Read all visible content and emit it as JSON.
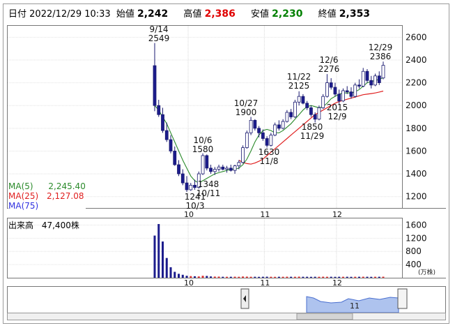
{
  "header": {
    "date_label": "日付",
    "datetime": "2022/12/29 10:33",
    "open_label": "始値",
    "open_value": "2,242",
    "high_label": "高値",
    "high_value": "2,386",
    "low_label": "安値",
    "low_value": "2,230",
    "close_label": "終値",
    "close_value": "2,353",
    "colors": {
      "high": "#e00000",
      "low": "#008000",
      "text": "#000000"
    }
  },
  "legend": {
    "ma5_label": "MA(5)",
    "ma5_value": "2,245.40",
    "ma5_color": "#2a8a2a",
    "ma25_label": "MA(25)",
    "ma25_value": "2,127.08",
    "ma25_color": "#e02020",
    "ma75_label": "MA(75)",
    "ma75_color": "#3030e0"
  },
  "volume_panel": {
    "label": "出来高",
    "value": "47,400株",
    "unit": "(万株)"
  },
  "navigator": {
    "left_handle_icon": "chevron-left-icon",
    "month_label": "11"
  },
  "chart_data": [
    {
      "type": "candlestick",
      "price_ticks": [
        "1200",
        "1400",
        "1600",
        "1800",
        "2000",
        "2200",
        "2400",
        "2600"
      ],
      "ylim": [
        1100,
        2700
      ],
      "month_ticks": [
        "10",
        "11",
        "12"
      ],
      "annotations": [
        {
          "text": "9/14",
          "value": "2549"
        },
        {
          "text": "10/6",
          "value": "1580"
        },
        {
          "text": "1348",
          "value": "10/11"
        },
        {
          "text": "1241",
          "value": "10/3"
        },
        {
          "text": "10/27",
          "value": "1900"
        },
        {
          "text": "1630",
          "value": "11/8"
        },
        {
          "text": "11/22",
          "value": "2125"
        },
        {
          "text": "1850",
          "value": "11/29"
        },
        {
          "text": "12/6",
          "value": "2276"
        },
        {
          "text": "2015",
          "value": "12/9"
        },
        {
          "text": "12/29",
          "value": "2386"
        }
      ],
      "candles": [
        [
          2350,
          2549,
          1950,
          2000
        ],
        [
          2000,
          2050,
          1900,
          1920
        ],
        [
          1920,
          1980,
          1760,
          1780
        ],
        [
          1780,
          1850,
          1680,
          1700
        ],
        [
          1700,
          1740,
          1580,
          1600
        ],
        [
          1600,
          1640,
          1470,
          1480
        ],
        [
          1480,
          1520,
          1380,
          1400
        ],
        [
          1400,
          1440,
          1300,
          1320
        ],
        [
          1320,
          1380,
          1241,
          1260
        ],
        [
          1260,
          1320,
          1250,
          1300
        ],
        [
          1300,
          1348,
          1260,
          1280
        ],
        [
          1280,
          1420,
          1270,
          1400
        ],
        [
          1400,
          1580,
          1390,
          1560
        ],
        [
          1560,
          1570,
          1430,
          1450
        ],
        [
          1450,
          1480,
          1400,
          1420
        ],
        [
          1420,
          1460,
          1390,
          1440
        ],
        [
          1440,
          1480,
          1420,
          1460
        ],
        [
          1460,
          1480,
          1430,
          1440
        ],
        [
          1440,
          1470,
          1410,
          1450
        ],
        [
          1450,
          1480,
          1420,
          1430
        ],
        [
          1430,
          1480,
          1400,
          1470
        ],
        [
          1470,
          1520,
          1440,
          1500
        ],
        [
          1500,
          1650,
          1490,
          1630
        ],
        [
          1630,
          1780,
          1620,
          1760
        ],
        [
          1760,
          1900,
          1740,
          1870
        ],
        [
          1870,
          1880,
          1780,
          1800
        ],
        [
          1800,
          1820,
          1720,
          1760
        ],
        [
          1760,
          1790,
          1690,
          1710
        ],
        [
          1710,
          1730,
          1630,
          1650
        ],
        [
          1650,
          1760,
          1640,
          1740
        ],
        [
          1740,
          1850,
          1730,
          1830
        ],
        [
          1830,
          1870,
          1780,
          1800
        ],
        [
          1800,
          1880,
          1790,
          1860
        ],
        [
          1860,
          1960,
          1850,
          1940
        ],
        [
          1940,
          1970,
          1880,
          1900
        ],
        [
          1900,
          2050,
          1890,
          2030
        ],
        [
          2030,
          2125,
          2000,
          2080
        ],
        [
          2080,
          2100,
          2010,
          2020
        ],
        [
          2020,
          2040,
          1960,
          1980
        ],
        [
          1980,
          2000,
          1900,
          1920
        ],
        [
          1920,
          1940,
          1850,
          1880
        ],
        [
          1880,
          2000,
          1870,
          1980
        ],
        [
          1980,
          2100,
          1970,
          2080
        ],
        [
          2080,
          2276,
          2070,
          2200
        ],
        [
          2200,
          2240,
          2140,
          2160
        ],
        [
          2160,
          2200,
          2080,
          2100
        ],
        [
          2100,
          2140,
          2015,
          2040
        ],
        [
          2040,
          2150,
          2030,
          2130
        ],
        [
          2130,
          2170,
          2100,
          2120
        ],
        [
          2120,
          2160,
          2060,
          2080
        ],
        [
          2080,
          2200,
          2070,
          2180
        ],
        [
          2180,
          2230,
          2150,
          2170
        ],
        [
          2170,
          2330,
          2160,
          2300
        ],
        [
          2300,
          2320,
          2200,
          2220
        ],
        [
          2220,
          2260,
          2150,
          2180
        ],
        [
          2180,
          2280,
          2170,
          2260
        ],
        [
          2260,
          2300,
          2180,
          2200
        ],
        [
          2242,
          2386,
          2230,
          2353
        ]
      ],
      "ma5": [
        2000,
        1960,
        1900,
        1840,
        1760,
        1680,
        1600,
        1520,
        1450,
        1380,
        1340,
        1320,
        1340,
        1360,
        1380,
        1400,
        1410,
        1420,
        1430,
        1440,
        1440,
        1450,
        1480,
        1530,
        1600,
        1680,
        1740,
        1780,
        1790,
        1780,
        1760,
        1760,
        1780,
        1810,
        1840,
        1880,
        1920,
        1960,
        1990,
        2000,
        1990,
        1980,
        1990,
        2020,
        2060,
        2080,
        2100,
        2110,
        2110,
        2110,
        2120,
        2140,
        2170,
        2200,
        2210,
        2220,
        2230,
        2245
      ],
      "ma25": [
        null,
        null,
        null,
        null,
        null,
        null,
        null,
        null,
        null,
        null,
        null,
        null,
        null,
        null,
        null,
        null,
        null,
        null,
        null,
        null,
        null,
        1520,
        1500,
        1490,
        1485,
        1495,
        1510,
        1530,
        1560,
        1590,
        1620,
        1650,
        1680,
        1710,
        1740,
        1770,
        1800,
        1830,
        1860,
        1890,
        1920,
        1940,
        1960,
        1980,
        2000,
        2020,
        2035,
        2045,
        2055,
        2065,
        2075,
        2085,
        2095,
        2100,
        2105,
        2110,
        2118,
        2127
      ]
    },
    {
      "type": "bar",
      "title": "出来高",
      "ticks": [
        "400",
        "800",
        "1200",
        "1600"
      ],
      "ylim": [
        0,
        1800
      ],
      "month_ticks": [
        "10",
        "11",
        "12"
      ],
      "values": [
        1280,
        1630,
        1100,
        600,
        320,
        180,
        120,
        90,
        60,
        50,
        45,
        40,
        60,
        55,
        40,
        35,
        35,
        30,
        30,
        30,
        32,
        30,
        38,
        34,
        30,
        30,
        28,
        30,
        32,
        30,
        28,
        30,
        30,
        32,
        30,
        30,
        34,
        30,
        30,
        28,
        30,
        30,
        32,
        30,
        30,
        28,
        30,
        30,
        30,
        28,
        30,
        30,
        32,
        30,
        28,
        30,
        30,
        32
      ]
    }
  ]
}
